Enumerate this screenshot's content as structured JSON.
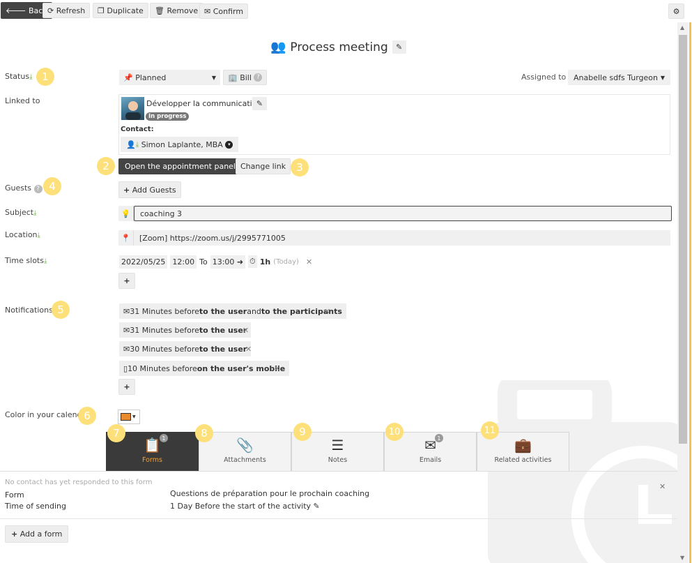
{
  "toolbar": {
    "back": "Back",
    "refresh": "Refresh",
    "duplicate": "Duplicate",
    "remove": "Remove",
    "confirm": "Confirm"
  },
  "title": "Process meeting",
  "badges": [
    "1",
    "2",
    "3",
    "4",
    "5",
    "6",
    "7",
    "8",
    "9",
    "10",
    "11"
  ],
  "labels": {
    "status": "Status",
    "linked_to": "Linked to",
    "guests": "Guests",
    "subject": "Subject",
    "location": "Location",
    "time_slots": "Time slots",
    "notifications": "Notifications",
    "color": "Color in your calenda"
  },
  "status": {
    "value": "Planned",
    "bill": "Bill",
    "assigned_label": "Assigned to",
    "assigned_value": "Anabelle sdfs Turgeon - ("
  },
  "linked": {
    "name": "Développer la communication",
    "state": "In progress",
    "contact_label": "Contact:",
    "contact": "Simon Laplante, MBA"
  },
  "actions": {
    "open_panel": "Open the appointment panel",
    "change_link": "Change link",
    "add_guests": "Add Guests"
  },
  "subject": "coaching 3",
  "location": "[Zoom] https://zoom.us/j/2995771005",
  "time": {
    "date": "2022/05/25",
    "start": "12:00",
    "to": "To",
    "end": "13:00",
    "duration": "1h",
    "today": "(Today)"
  },
  "notifications": [
    {
      "pre": "31 Minutes before ",
      "b1": "to the user",
      "mid": " and ",
      "b2": "to the participants"
    },
    {
      "pre": "31 Minutes before ",
      "b1": "to the user",
      "mid": "",
      "b2": ""
    },
    {
      "pre": "30 Minutes before ",
      "b1": "to the user",
      "mid": "",
      "b2": ""
    },
    {
      "pre": "10 Minutes before ",
      "b1": "on the user's mobile",
      "mid": "",
      "b2": ""
    }
  ],
  "color_value": "#e88a2e",
  "tabs": [
    {
      "label": "Forms",
      "count": "1"
    },
    {
      "label": "Attachments",
      "count": ""
    },
    {
      "label": "Notes",
      "count": ""
    },
    {
      "label": "Emails",
      "count": "1"
    },
    {
      "label": "Related activities",
      "count": ""
    }
  ],
  "form_section": {
    "no_response": "No contact has yet responded to this form",
    "form_label": "Form",
    "form_value": "Questions de préparation pour le prochain coaching",
    "time_label": "Time of sending",
    "time_value": "1 Day Before the start of the activity",
    "add_form": "Add a form"
  }
}
